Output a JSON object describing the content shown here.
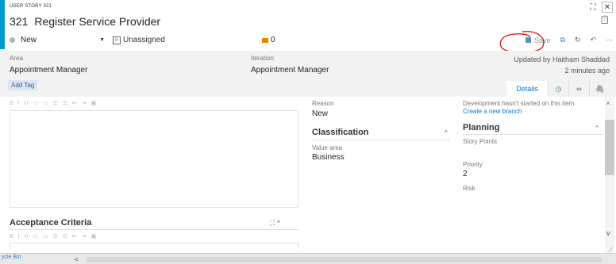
{
  "header": {
    "type": "USER STORY 321",
    "id": "321",
    "title": "Register Service Provider",
    "state": "New",
    "assigned": "Unassigned",
    "discussion_count": "0",
    "save_label": "Save"
  },
  "fields": {
    "area_label": "Area",
    "area_value": "Appointment Manager",
    "iteration_label": "Iteration",
    "iteration_value": "Appointment Manager",
    "updated_by": "Updated by Haitham Shaddad",
    "updated_when": "2 minutes ago",
    "add_tag": "Add Tag"
  },
  "tabs": {
    "details": "Details"
  },
  "middle": {
    "reason_label": "Reason",
    "reason_value": "New",
    "classification": "Classification",
    "value_area_label": "Value area",
    "value_area_value": "Business"
  },
  "right": {
    "dev_status": "Development hasn't started on this item.",
    "create_branch": "Create a new branch",
    "planning": "Planning",
    "story_points_label": "Story Points",
    "priority_label": "Priority",
    "priority_value": "2",
    "risk_label": "Risk"
  },
  "left": {
    "toolbar_glyphs": "B I U ▭ ▭ ☰ ☰ ⇤ ⇥ ▣",
    "acceptance_criteria": "Acceptance Criteria"
  },
  "bottom": {
    "link": "ycle Bin"
  },
  "colors": {
    "accent": "#009ccc",
    "discussion": "#f08000",
    "link": "#0078d7",
    "annotation": "#e0201e"
  }
}
